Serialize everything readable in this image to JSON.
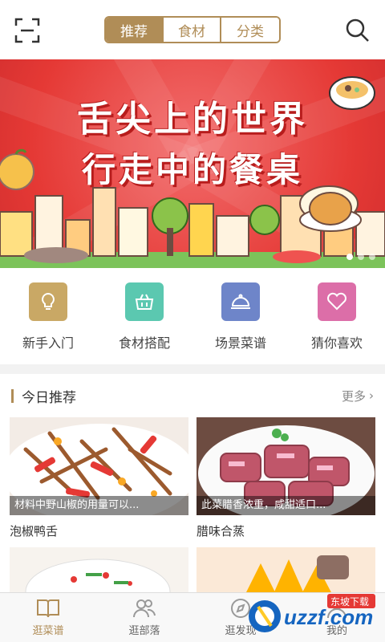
{
  "header": {
    "scan_icon": "scan-icon",
    "search_icon": "search-icon",
    "tabs": [
      {
        "label": "推荐",
        "active": true
      },
      {
        "label": "食材",
        "active": false
      },
      {
        "label": "分类",
        "active": false
      }
    ]
  },
  "banner": {
    "line1": "舌尖上的世界",
    "line2": "行走中的餐桌",
    "dots": 3,
    "active_dot": 1
  },
  "quick_entries": [
    {
      "label": "新手入门",
      "icon": "lightbulb-icon",
      "color": "#c9a865"
    },
    {
      "label": "食材搭配",
      "icon": "basket-icon",
      "color": "#5bc8b0"
    },
    {
      "label": "场景菜谱",
      "icon": "dish-cover-icon",
      "color": "#6e85c9"
    },
    {
      "label": "猜你喜欢",
      "icon": "heart-icon",
      "color": "#dc6ea8"
    }
  ],
  "today": {
    "title": "今日推荐",
    "more": "更多",
    "cards": [
      {
        "caption": "材料中野山椒的用量可以...",
        "name": "泡椒鸭舌"
      },
      {
        "caption": "此菜腊香浓重，咸甜适口...",
        "name": "腊味合蒸"
      }
    ]
  },
  "bottom_nav": [
    {
      "label": "逛菜谱",
      "icon": "book-icon",
      "active": true
    },
    {
      "label": "逛部落",
      "icon": "people-icon",
      "active": false
    },
    {
      "label": "逛发现",
      "icon": "discover-icon",
      "active": false
    },
    {
      "label": "我的",
      "icon": "user-icon",
      "active": false
    }
  ],
  "watermark": {
    "text": "uzzf.com",
    "subtext": "东坡下载"
  },
  "colors": {
    "accent": "#b08d57",
    "banner": "#e53935"
  }
}
